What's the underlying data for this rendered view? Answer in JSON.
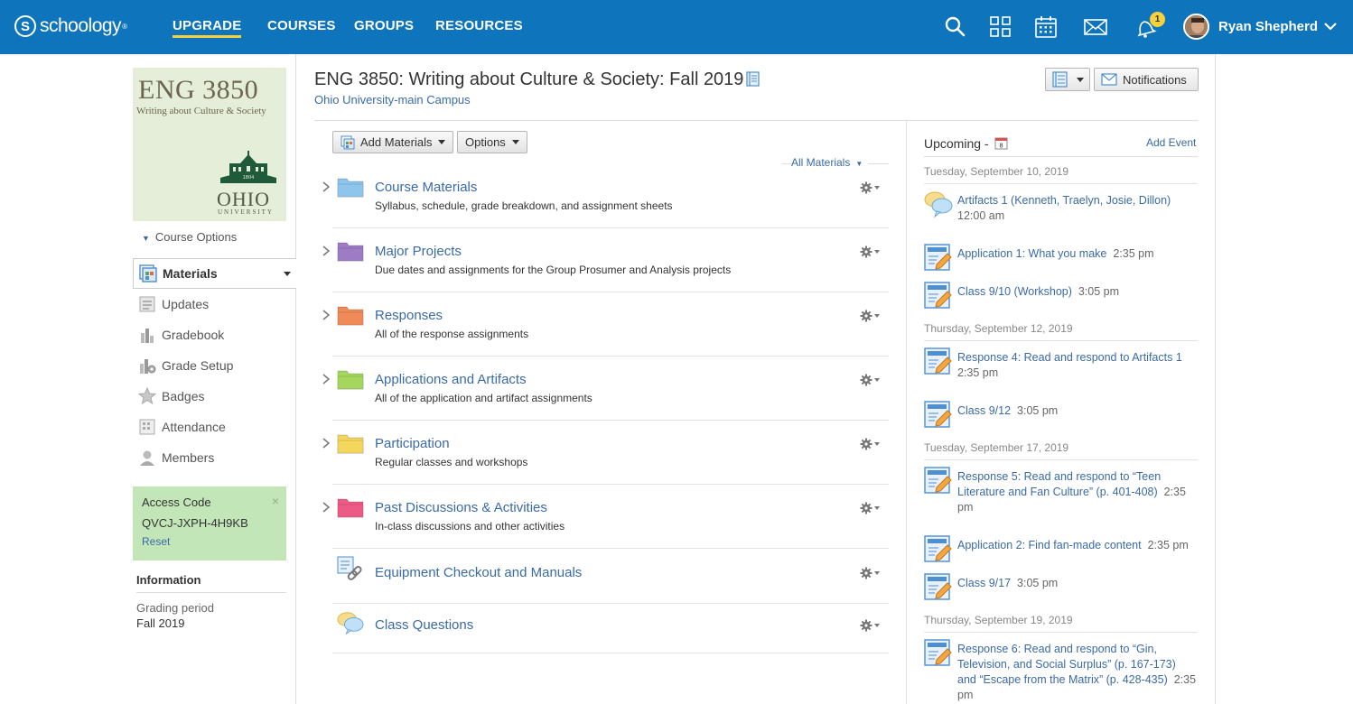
{
  "topnav": {
    "logo": "schoology",
    "links": [
      "UPGRADE",
      "COURSES",
      "GROUPS",
      "RESOURCES"
    ],
    "notification_count": "1",
    "user_name": "Ryan Shepherd"
  },
  "sidebar": {
    "course_logo": {
      "code": "ENG 3850",
      "subtitle": "Writing about Culture & Society",
      "ohio": "OHIO",
      "university": "UNIVERSITY",
      "seal_year": "1804"
    },
    "course_options": "Course Options",
    "nav": [
      "Materials",
      "Updates",
      "Gradebook",
      "Grade Setup",
      "Badges",
      "Attendance",
      "Members"
    ],
    "access": {
      "title": "Access Code",
      "code": "QVCJ-JXPH-4H9KB",
      "reset": "Reset",
      "close": "×"
    },
    "info": {
      "title": "Information",
      "label": "Grading period",
      "value": "Fall 2019"
    }
  },
  "header": {
    "title": "ENG 3850: Writing about Culture & Society: Fall 2019",
    "campus": "Ohio University-main Campus",
    "notifications": "Notifications"
  },
  "materials": {
    "add_materials": "Add Materials",
    "options": "Options",
    "filter": "All Materials",
    "folders": [
      {
        "title": "Course Materials",
        "desc": "Syllabus, schedule, grade breakdown, and assignment sheets",
        "color": "#8ec5ec"
      },
      {
        "title": "Major Projects",
        "desc": "Due dates and assignments for the Group Prosumer and Analysis projects",
        "color": "#9d7cc5"
      },
      {
        "title": "Responses",
        "desc": "All of the response assignments",
        "color": "#f08a58"
      },
      {
        "title": "Applications and Artifacts",
        "desc": "All of the application and artifact assignments",
        "color": "#a5d65e"
      },
      {
        "title": "Participation",
        "desc": "Regular classes and workshops",
        "color": "#f4d65c"
      },
      {
        "title": "Past Discussions & Activities",
        "desc": "In-class discussions and other activities",
        "color": "#ee5a86"
      },
      {
        "title": "Equipment Checkout and Manuals",
        "desc": ""
      },
      {
        "title": "Class Questions",
        "desc": ""
      }
    ]
  },
  "upcoming": {
    "title": "Upcoming -",
    "cal_day": "8",
    "add_event": "Add Event",
    "dates": [
      "Tuesday, September 10, 2019",
      "Thursday, September 12, 2019",
      "Tuesday, September 17, 2019",
      "Thursday, September 19, 2019"
    ],
    "items": [
      {
        "title": "Artifacts 1 (Kenneth, Traelyn, Josie, Dillon)",
        "time": "12:00 am"
      },
      {
        "title": "Application 1: What you make",
        "time": "2:35 pm"
      },
      {
        "title": "Class 9/10 (Workshop)",
        "time": "3:05 pm"
      },
      {
        "title": "Response 4: Read and respond to Artifacts 1",
        "time": "2:35 pm"
      },
      {
        "title": "Class 9/12",
        "time": "3:05 pm"
      },
      {
        "title": "Response 5: Read and respond to “Teen Literature and Fan Culture” (p. 401-408)",
        "time": "2:35 pm"
      },
      {
        "title": "Application 2: Find fan-made content",
        "time": "2:35 pm"
      },
      {
        "title": "Class 9/17",
        "time": "3:05 pm"
      },
      {
        "title": "Response 6: Read and respond to “Gin, Television, and Social Surplus” (p. 167-173) and “Escape from the Matrix” (p. 428-435)",
        "time": "2:35 pm"
      }
    ]
  },
  "colors": {
    "topbar": "#0e75bc",
    "link": "#3a6aa7",
    "access_bg": "#c3e6b9",
    "accent": "#f5d23b"
  },
  "icons": [
    "search-icon",
    "apps-grid-icon",
    "calendar-icon",
    "mail-icon",
    "bell-icon",
    "gear-icon",
    "folder-icon",
    "link-icon",
    "discussion-icon",
    "assignment-icon"
  ]
}
